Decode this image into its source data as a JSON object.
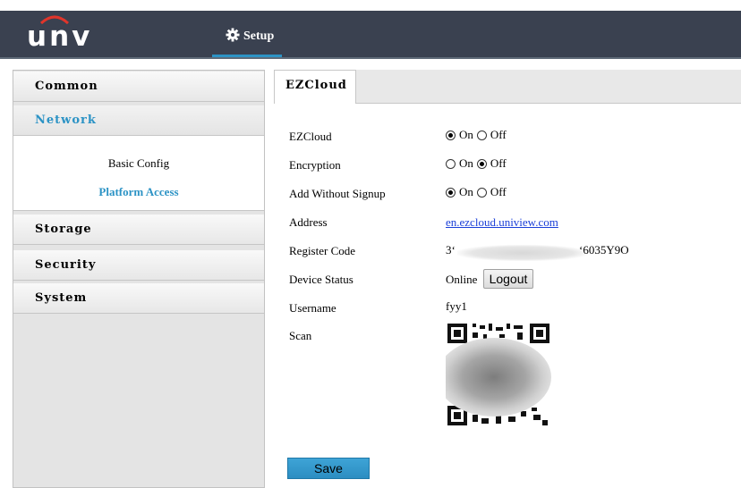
{
  "header": {
    "logo": "unv",
    "setup_label": "Setup"
  },
  "sidebar": {
    "common": "Common",
    "network": "Network",
    "network_items": [
      "Basic Config",
      "Platform Access"
    ],
    "storage": "Storage",
    "security": "Security",
    "system": "System"
  },
  "main": {
    "tab": "EZCloud",
    "fields": {
      "ezcloud_label": "EZCloud",
      "encryption_label": "Encryption",
      "add_without_signup_label": "Add Without Signup",
      "address_label": "Address",
      "register_code_label": "Register Code",
      "device_status_label": "Device Status",
      "username_label": "Username",
      "scan_label": "Scan"
    },
    "radio": {
      "on": "On",
      "off": "Off"
    },
    "ezcloud_value": "On",
    "encryption_value": "Off",
    "add_without_signup_value": "On",
    "address": "en.ezcloud.uniview.com",
    "register_code_prefix": "3‘",
    "register_code_suffix": "‘6035Y9O",
    "device_status": "Online",
    "logout_label": "Logout",
    "username": "fyy1",
    "save_label": "Save"
  },
  "colors": {
    "topbar": "#3a4150",
    "accent": "#2c93c5",
    "link": "#1a3fd8"
  }
}
